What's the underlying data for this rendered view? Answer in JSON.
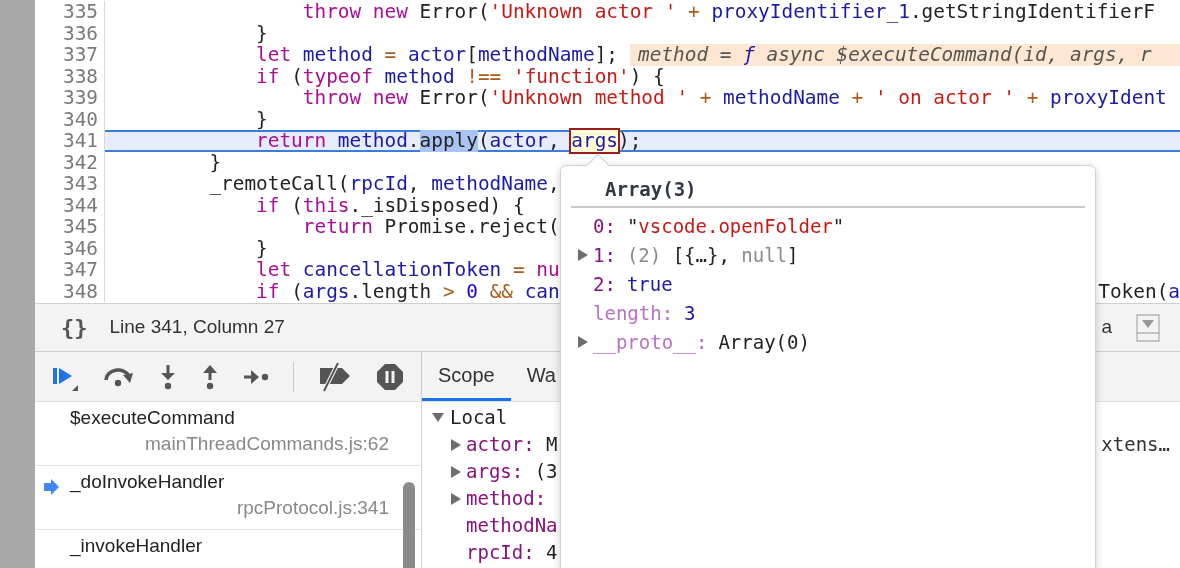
{
  "editor": {
    "lines": [
      {
        "number": "335",
        "current": false,
        "tokens": [
          {
            "text": "                throw new",
            "kind": "keyword"
          },
          {
            "text": " Error(",
            "kind": "plain"
          },
          {
            "text": "'Unknown actor '",
            "kind": "string"
          },
          {
            "text": " + ",
            "kind": "operator"
          },
          {
            "text": "proxyIdentifier_1",
            "kind": "variable"
          },
          {
            "text": ".getStringIdentifierF",
            "kind": "plain"
          }
        ]
      },
      {
        "number": "336",
        "current": false,
        "tokens": [
          {
            "text": "            }",
            "kind": "plain"
          }
        ]
      },
      {
        "number": "337",
        "current": false,
        "tokens": [
          {
            "text": "            let ",
            "kind": "keyword"
          },
          {
            "text": "method",
            "kind": "variable"
          },
          {
            "text": " = ",
            "kind": "operator"
          },
          {
            "text": "actor",
            "kind": "variable"
          },
          {
            "text": "[",
            "kind": "plain"
          },
          {
            "text": "methodName",
            "kind": "variable"
          },
          {
            "text": "];",
            "kind": "plain"
          }
        ],
        "inline_value": [
          {
            "text": "method = ",
            "kind": "plain"
          },
          {
            "text": "ƒ",
            "kind": "function"
          },
          {
            "text": " async $executeCommand(id, args, r",
            "kind": "plain"
          }
        ]
      },
      {
        "number": "338",
        "current": false,
        "tokens": [
          {
            "text": "            if",
            "kind": "keyword"
          },
          {
            "text": " (",
            "kind": "plain"
          },
          {
            "text": "typeof ",
            "kind": "keyword"
          },
          {
            "text": "method",
            "kind": "variable"
          },
          {
            "text": " !== ",
            "kind": "operator"
          },
          {
            "text": "'function'",
            "kind": "string"
          },
          {
            "text": ") {",
            "kind": "plain"
          }
        ]
      },
      {
        "number": "339",
        "current": false,
        "tokens": [
          {
            "text": "                throw new",
            "kind": "keyword"
          },
          {
            "text": " Error(",
            "kind": "plain"
          },
          {
            "text": "'Unknown method '",
            "kind": "string"
          },
          {
            "text": " + ",
            "kind": "operator"
          },
          {
            "text": "methodName",
            "kind": "variable"
          },
          {
            "text": " + ",
            "kind": "operator"
          },
          {
            "text": "' on actor '",
            "kind": "string"
          },
          {
            "text": " + ",
            "kind": "operator"
          },
          {
            "text": "proxyIdent",
            "kind": "variable"
          }
        ]
      },
      {
        "number": "340",
        "current": false,
        "tokens": [
          {
            "text": "            }",
            "kind": "plain"
          }
        ]
      },
      {
        "number": "341",
        "current": true,
        "tokens": [
          {
            "text": "            return ",
            "kind": "keyword"
          },
          {
            "text": "method",
            "kind": "variable"
          },
          {
            "text": ".",
            "kind": "plain"
          },
          {
            "text": "apply",
            "kind": "plain",
            "selected": true
          },
          {
            "text": "(",
            "kind": "plain"
          },
          {
            "text": "actor",
            "kind": "variable"
          },
          {
            "text": ", ",
            "kind": "plain"
          },
          {
            "text": "args",
            "kind": "variable",
            "hovered": true
          },
          {
            "text": ");",
            "kind": "plain"
          }
        ]
      },
      {
        "number": "342",
        "current": false,
        "tokens": [
          {
            "text": "        }",
            "kind": "plain"
          }
        ]
      },
      {
        "number": "343",
        "current": false,
        "tokens": [
          {
            "text": "        _remoteCall(",
            "kind": "plain"
          },
          {
            "text": "rpcId",
            "kind": "variable"
          },
          {
            "text": ", ",
            "kind": "plain"
          },
          {
            "text": "methodName",
            "kind": "variable"
          },
          {
            "text": ",",
            "kind": "plain"
          }
        ]
      },
      {
        "number": "344",
        "current": false,
        "tokens": [
          {
            "text": "            if",
            "kind": "keyword"
          },
          {
            "text": " (",
            "kind": "plain"
          },
          {
            "text": "this",
            "kind": "keyword"
          },
          {
            "text": "._isDisposed) {",
            "kind": "plain"
          }
        ]
      },
      {
        "number": "345",
        "current": false,
        "tokens": [
          {
            "text": "                return",
            "kind": "keyword"
          },
          {
            "text": " Promise.reject(",
            "kind": "plain"
          }
        ]
      },
      {
        "number": "346",
        "current": false,
        "tokens": [
          {
            "text": "            }",
            "kind": "plain"
          }
        ]
      },
      {
        "number": "347",
        "current": false,
        "tokens": [
          {
            "text": "            let ",
            "kind": "keyword"
          },
          {
            "text": "cancellationToken",
            "kind": "variable"
          },
          {
            "text": " = ",
            "kind": "operator"
          },
          {
            "text": "nu",
            "kind": "keyword"
          }
        ]
      },
      {
        "number": "348",
        "current": false,
        "tokens": [
          {
            "text": "            if",
            "kind": "keyword"
          },
          {
            "text": " (",
            "kind": "plain"
          },
          {
            "text": "args",
            "kind": "variable"
          },
          {
            "text": ".length ",
            "kind": "plain"
          },
          {
            "text": "> ",
            "kind": "operator"
          },
          {
            "text": "0",
            "kind": "number"
          },
          {
            "text": " && ",
            "kind": "operator"
          },
          {
            "text": "can",
            "kind": "variable"
          }
        ],
        "tail": [
          {
            "text": "Token(",
            "kind": "plain"
          },
          {
            "text": "a",
            "kind": "variable"
          }
        ]
      }
    ]
  },
  "status_bar": {
    "format_button": "{}",
    "position": "Line 341, Column 27",
    "right_text": "a"
  },
  "call_stack": [
    {
      "name": "$executeCommand",
      "location": "mainThreadCommands.js:62",
      "selected": false
    },
    {
      "name": "_doInvokeHandler",
      "location": "rpcProtocol.js:341",
      "selected": true
    },
    {
      "name": "_invokeHandler",
      "selected": false
    }
  ],
  "sidebar_tabs": [
    {
      "label": "Scope",
      "selected": true
    },
    {
      "label": "Wa",
      "selected": false
    }
  ],
  "scope": [
    {
      "label": "Local",
      "expanded": true,
      "children": [
        {
          "key": "actor:",
          "expandable": true,
          "value": "M",
          "tail": "xtens…"
        },
        {
          "key": "args:",
          "expandable": true,
          "value": "(3"
        },
        {
          "key": "method:",
          "expandable": true
        },
        {
          "key": "methodNa",
          "expandable": false
        },
        {
          "key": "rpcId:",
          "expandable": false,
          "value": "4"
        }
      ]
    }
  ],
  "popover": {
    "title": "Array(3)",
    "rows": [
      {
        "key": "0:",
        "kind": "index",
        "expandable": false,
        "value": [
          {
            "text": "\"",
            "kind": "plain"
          },
          {
            "text": "vscode.openFolder",
            "kind": "string"
          },
          {
            "text": "\"",
            "kind": "plain"
          }
        ]
      },
      {
        "key": "1:",
        "kind": "index",
        "expandable": true,
        "value": [
          {
            "text": "(2) ",
            "kind": "dim"
          },
          {
            "text": "[{…}, ",
            "kind": "plain"
          },
          {
            "text": "null",
            "kind": "dim"
          },
          {
            "text": "]",
            "kind": "plain"
          }
        ]
      },
      {
        "key": "2:",
        "kind": "index",
        "expandable": false,
        "value": [
          {
            "text": "true",
            "kind": "primitive"
          }
        ]
      },
      {
        "key": "length:",
        "kind": "internal",
        "expandable": false,
        "value": [
          {
            "text": "3",
            "kind": "primitive"
          }
        ]
      },
      {
        "key": "__proto__:",
        "kind": "internal",
        "expandable": true,
        "value": [
          {
            "text": "Array(0)",
            "kind": "plain"
          }
        ]
      }
    ]
  }
}
